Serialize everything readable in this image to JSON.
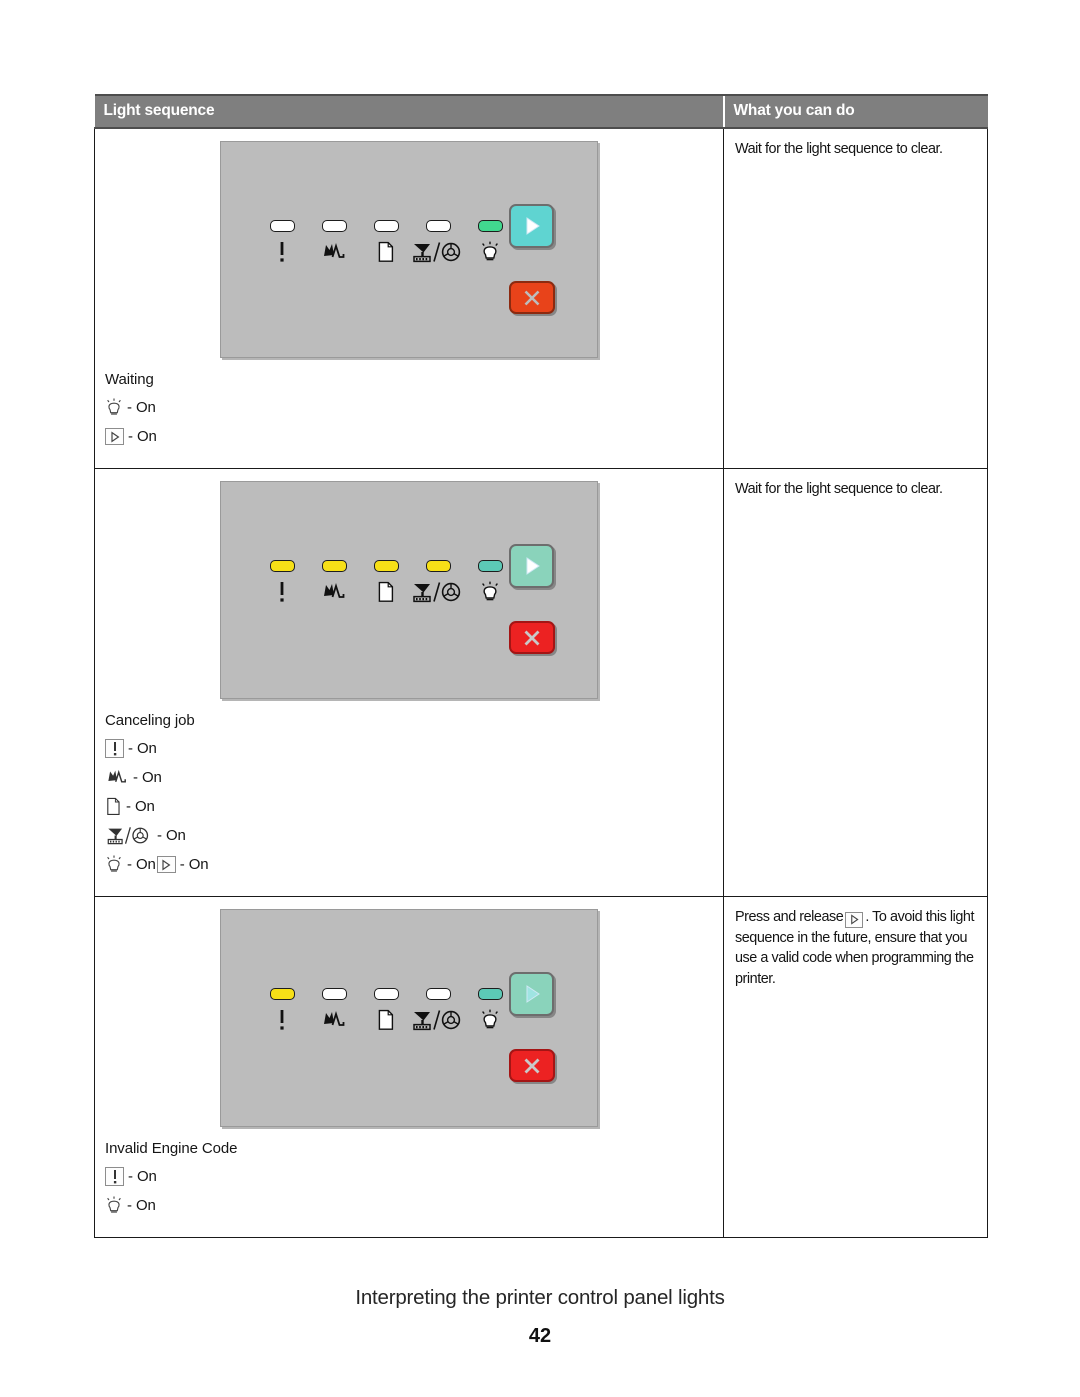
{
  "document": {
    "footer_section": "Interpreting the printer control panel lights",
    "page_number": "42"
  },
  "table": {
    "headers": {
      "light_sequence": "Light sequence",
      "what_you_can_do": "What you can do"
    },
    "rows": [
      {
        "id": "waiting",
        "panel": {
          "leds": [
            {
              "name": "error-led",
              "glyph": "exclamation",
              "state": "off",
              "color": "#ffffff"
            },
            {
              "name": "paper-jam-led",
              "glyph": "paper-jam",
              "state": "off",
              "color": "#ffffff"
            },
            {
              "name": "load-paper-led",
              "glyph": "paper",
              "state": "off",
              "color": "#ffffff"
            },
            {
              "name": "toner-led",
              "glyph": "toner-paper",
              "state": "off",
              "color": "#ffffff"
            },
            {
              "name": "ready-led",
              "glyph": "ready",
              "state": "on",
              "color": "#41d88f"
            }
          ],
          "continue_button": {
            "label": "Continue",
            "color": "#5fd4d1"
          },
          "cancel_button": {
            "label": "Cancel",
            "color": "#e8431a"
          }
        },
        "caption_title": "Waiting",
        "states": [
          {
            "icons": [
              "ready"
            ],
            "text": "- On"
          },
          {
            "icons": [
              "continue"
            ],
            "text": "- On"
          }
        ],
        "action": "Wait for the light sequence to clear."
      },
      {
        "id": "canceling-job",
        "panel": {
          "leds": [
            {
              "name": "error-led",
              "glyph": "exclamation",
              "state": "on",
              "color": "#f7e017"
            },
            {
              "name": "paper-jam-led",
              "glyph": "paper-jam",
              "state": "on",
              "color": "#f7e017"
            },
            {
              "name": "load-paper-led",
              "glyph": "paper",
              "state": "on",
              "color": "#f7e017"
            },
            {
              "name": "toner-led",
              "glyph": "toner-paper",
              "state": "on",
              "color": "#f7e017"
            },
            {
              "name": "ready-led",
              "glyph": "ready",
              "state": "on",
              "color": "#5cc9b6"
            }
          ],
          "continue_button": {
            "label": "Continue",
            "color": "#8ad3bb"
          },
          "cancel_button": {
            "label": "Cancel",
            "color": "#ec2222"
          }
        },
        "caption_title": "Canceling job",
        "states": [
          {
            "icons": [
              "error"
            ],
            "text": "- On"
          },
          {
            "icons": [
              "paper-jam"
            ],
            "text": "- On"
          },
          {
            "icons": [
              "paper"
            ],
            "text": "- On"
          },
          {
            "icons": [
              "toner-paper"
            ],
            "text": "- On"
          },
          {
            "icons": [
              "ready"
            ],
            "text": "- On",
            "icons2": [
              "continue"
            ],
            "text2": "- On"
          }
        ],
        "action": "Wait for the light sequence to clear."
      },
      {
        "id": "invalid-engine-code",
        "panel": {
          "leds": [
            {
              "name": "error-led",
              "glyph": "exclamation",
              "state": "on",
              "color": "#f7e017"
            },
            {
              "name": "paper-jam-led",
              "glyph": "paper-jam",
              "state": "off",
              "color": "#ffffff"
            },
            {
              "name": "load-paper-led",
              "glyph": "paper",
              "state": "off",
              "color": "#ffffff"
            },
            {
              "name": "toner-led",
              "glyph": "toner-paper",
              "state": "off",
              "color": "#ffffff"
            },
            {
              "name": "ready-led",
              "glyph": "ready",
              "state": "on",
              "color": "#5cc9b6"
            }
          ],
          "continue_button": {
            "label": "Continue",
            "color": "#8ad3bb"
          },
          "cancel_button": {
            "label": "Cancel",
            "color": "#ec2222"
          }
        },
        "caption_title": "Invalid Engine Code",
        "states": [
          {
            "icons": [
              "error"
            ],
            "text": "- On"
          },
          {
            "icons": [
              "ready"
            ],
            "text": "- On"
          }
        ],
        "action_parts": {
          "before": "Press and release",
          "icon": "continue",
          "after": ". To avoid this light sequence in the future, ensure that you use a valid code when programming the printer."
        }
      }
    ]
  }
}
